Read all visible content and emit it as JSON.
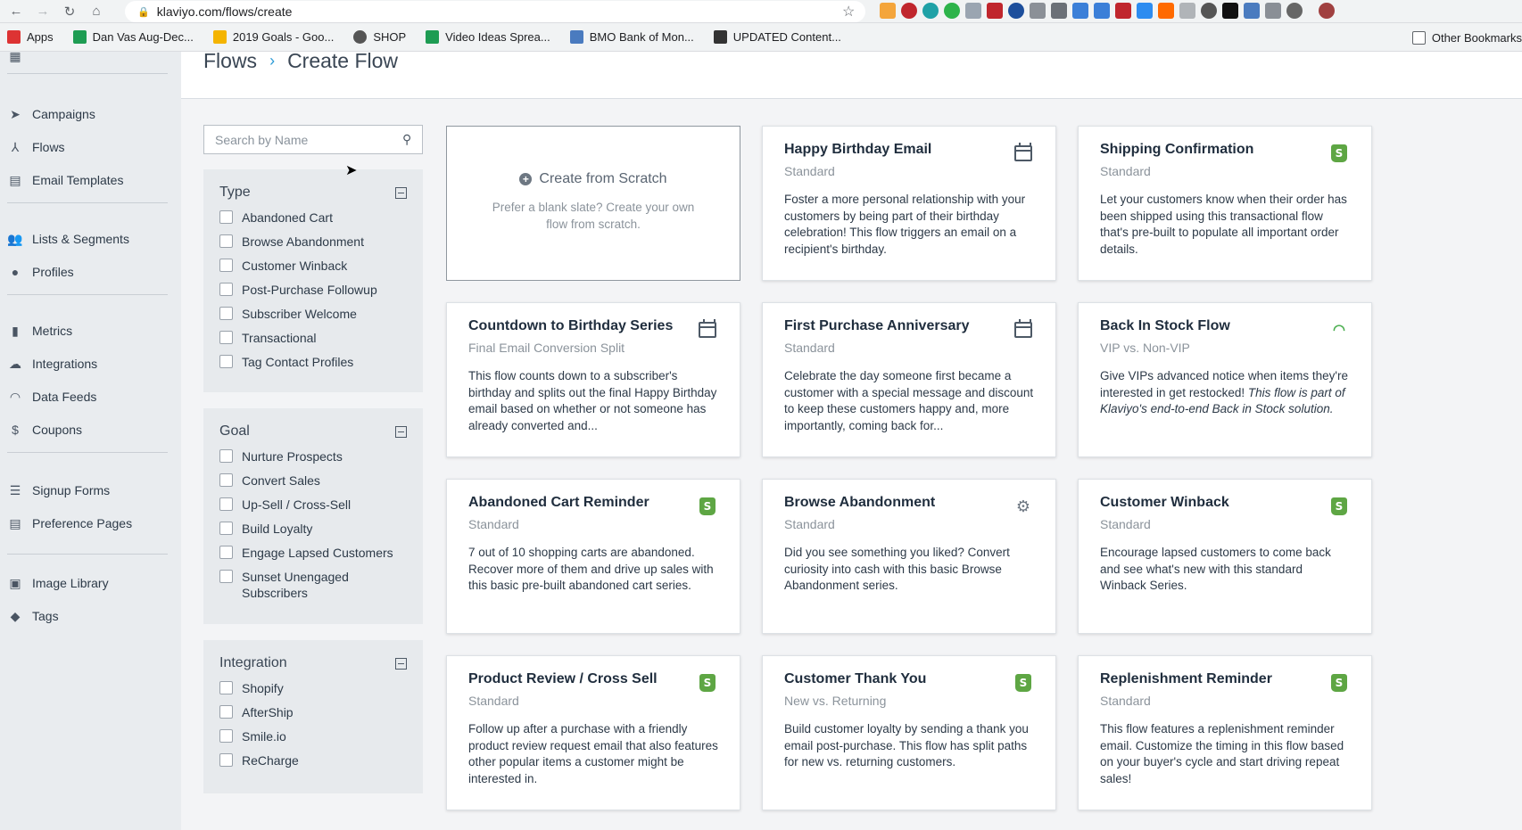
{
  "browser": {
    "url": "klaviyo.com/flows/create",
    "bookmarks": [
      "Apps",
      "Dan Vas Aug-Dec...",
      "2019 Goals - Goo...",
      "SHOP",
      "Video Ideas Sprea...",
      "BMO Bank of Mon...",
      "UPDATED Content..."
    ],
    "other_bookmarks": "Other Bookmarks"
  },
  "sidebar": {
    "items": [
      {
        "label": "Campaigns",
        "icon": "paper-plane-icon"
      },
      {
        "label": "Flows",
        "icon": "flow-icon"
      },
      {
        "label": "Email Templates",
        "icon": "template-icon"
      },
      {
        "label": "Lists & Segments",
        "icon": "users-icon"
      },
      {
        "label": "Profiles",
        "icon": "user-icon"
      },
      {
        "label": "Metrics",
        "icon": "bar-chart-icon"
      },
      {
        "label": "Integrations",
        "icon": "cloud-icon"
      },
      {
        "label": "Data Feeds",
        "icon": "rss-icon"
      },
      {
        "label": "Coupons",
        "icon": "dollar-icon"
      },
      {
        "label": "Signup Forms",
        "icon": "list-icon"
      },
      {
        "label": "Preference Pages",
        "icon": "card-icon"
      },
      {
        "label": "Image Library",
        "icon": "image-icon"
      },
      {
        "label": "Tags",
        "icon": "tag-icon"
      }
    ]
  },
  "header": {
    "crumb_parent": "Flows",
    "crumb_sep": "›",
    "crumb_current": "Create Flow"
  },
  "search": {
    "placeholder": "Search by Name"
  },
  "filters": {
    "type": {
      "title": "Type",
      "options": [
        "Abandoned Cart",
        "Browse Abandonment",
        "Customer Winback",
        "Post-Purchase Followup",
        "Subscriber Welcome",
        "Transactional",
        "Tag Contact Profiles"
      ]
    },
    "goal": {
      "title": "Goal",
      "options": [
        "Nurture Prospects",
        "Convert Sales",
        "Up-Sell / Cross-Sell",
        "Build Loyalty",
        "Engage Lapsed Customers",
        "Sunset Unengaged Subscribers"
      ]
    },
    "integration": {
      "title": "Integration",
      "options": [
        "Shopify",
        "AfterShip",
        "Smile.io",
        "ReCharge"
      ]
    }
  },
  "scratch": {
    "title": "Create from Scratch",
    "desc": "Prefer a blank slate? Create your own flow from scratch."
  },
  "cards": [
    {
      "title": "Happy Birthday Email",
      "sub": "Standard",
      "icon": "calendar-icon",
      "desc": "Foster a more personal relationship with your customers by being part of their birthday celebration! This flow triggers an email on a recipient's birthday."
    },
    {
      "title": "Shipping Confirmation",
      "sub": "Standard",
      "icon": "shopify-icon",
      "desc": "Let your customers know when their order has been shipped using this transactional flow that's pre-built to populate all important order details."
    },
    {
      "title": "Countdown to Birthday Series",
      "sub": "Final Email Conversion Split",
      "icon": "calendar-icon",
      "desc": "This flow counts down to a subscriber's birthday and splits out the final Happy Birthday email based on whether or not someone has already converted and..."
    },
    {
      "title": "First Purchase Anniversary",
      "sub": "Standard",
      "icon": "calendar-icon",
      "desc": "Celebrate the day someone first became a customer with a special message and discount to keep these customers happy and, more importantly, coming back for..."
    },
    {
      "title": "Back In Stock Flow",
      "sub": "VIP vs. Non-VIP",
      "icon": "signal-icon",
      "desc": "Give VIPs advanced notice when items they're interested in get restocked!",
      "desc_italic": "This flow is part of Klaviyo's end-to-end Back in Stock solution."
    },
    {
      "title": "Abandoned Cart Reminder",
      "sub": "Standard",
      "icon": "shopify-icon",
      "desc": "7 out of 10 shopping carts are abandoned. Recover more of them and drive up sales with this basic pre-built abandoned cart series."
    },
    {
      "title": "Browse Abandonment",
      "sub": "Standard",
      "icon": "gear-icon",
      "desc": "Did you see something you liked? Convert curiosity into cash with this basic Browse Abandonment series."
    },
    {
      "title": "Customer Winback",
      "sub": "Standard",
      "icon": "shopify-icon",
      "desc": "Encourage lapsed customers to come back and see what's new with this standard Winback Series."
    },
    {
      "title": "Product Review / Cross Sell",
      "sub": "Standard",
      "icon": "shopify-icon",
      "desc": "Follow up after a purchase with a friendly product review request email that also features other popular items a customer might be interested in."
    },
    {
      "title": "Customer Thank You",
      "sub": "New vs. Returning",
      "icon": "shopify-icon",
      "desc": "Build customer loyalty by sending a thank you email post-purchase. This flow has split paths for new vs. returning customers."
    },
    {
      "title": "Replenishment Reminder",
      "sub": "Standard",
      "icon": "shopify-icon",
      "desc": "This flow features a replenishment reminder email. Customize the timing in this flow based on your buyer's cycle and start driving repeat sales!"
    }
  ]
}
